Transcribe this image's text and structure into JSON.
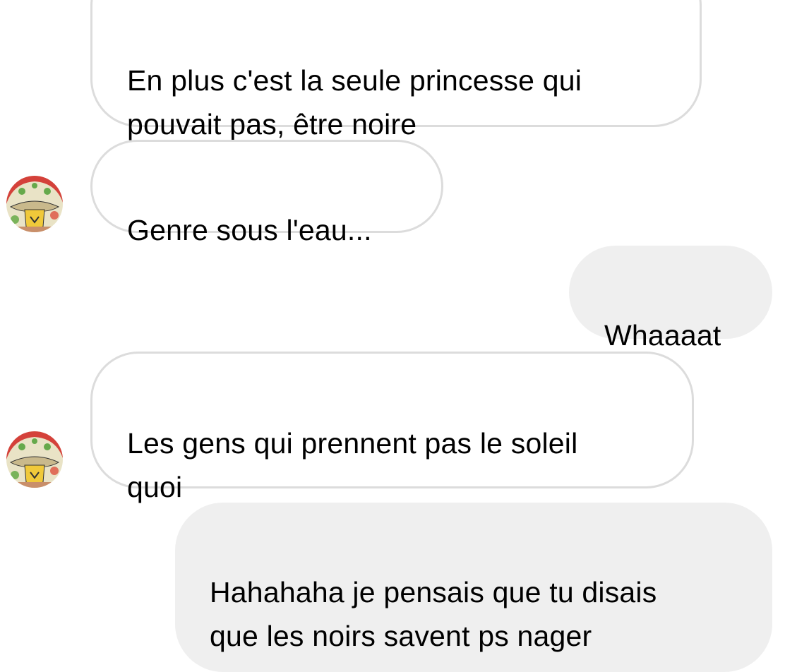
{
  "conversation": {
    "messages": [
      {
        "direction": "incoming",
        "text": "En plus c'est la seule princesse qui\npouvait pas, être noire"
      },
      {
        "direction": "incoming",
        "text": "Genre sous l'eau..."
      },
      {
        "direction": "outgoing",
        "text": "Whaaaat"
      },
      {
        "direction": "incoming",
        "text": "Les gens qui prennent pas le soleil\nquoi"
      },
      {
        "direction": "outgoing",
        "text": "Hahahaha je pensais que tu disais\nque les noirs savent ps nager"
      }
    ]
  },
  "colors": {
    "incoming_bubble_bg": "#ffffff",
    "incoming_bubble_border": "#dcdcdc",
    "outgoing_bubble_bg": "#efefef",
    "text": "#000000"
  },
  "icons": {
    "avatar": "psychedelic-mushroom-illustration"
  }
}
